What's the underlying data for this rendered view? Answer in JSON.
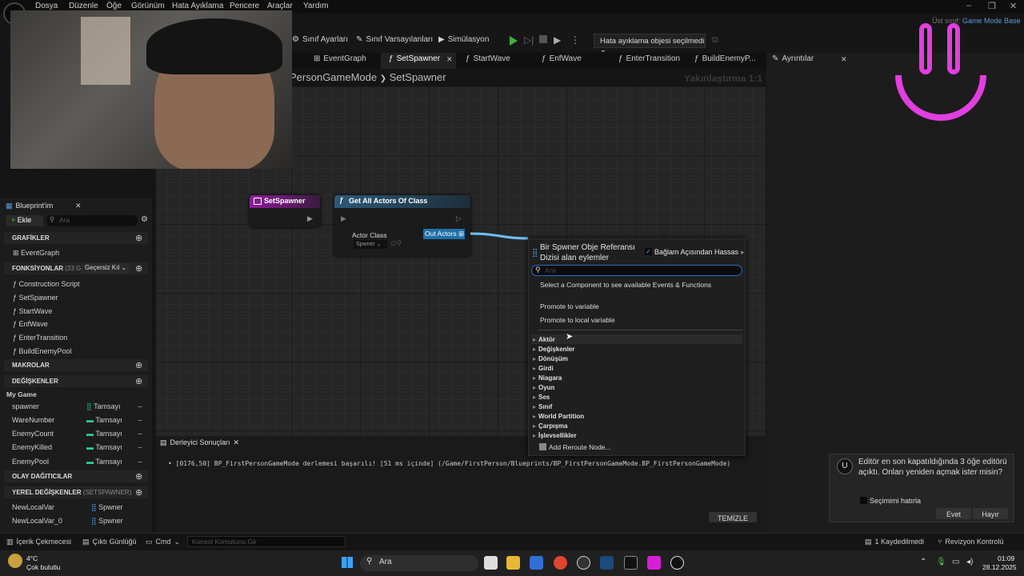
{
  "menubar": {
    "items": [
      "Dosya",
      "Düzenle",
      "Öğe",
      "Görünüm",
      "Hata Ayıklama",
      "Pencere",
      "Araçlar",
      "Yardım"
    ]
  },
  "parent_class": {
    "label": "Üst sınıf:",
    "value": "Game Mode Base"
  },
  "toolbar": {
    "class_settings": "Sınıf Ayarları",
    "class_defaults": "Sınıf Varsayılanları",
    "simulation": "Simülasyon",
    "debug_object": "Hata ayıklama objesi seçilmedi"
  },
  "tabs": [
    "EventGraph",
    "SetSpawner",
    "StartWave",
    "EnfWave",
    "EnterTransition",
    "BuildEnemyP..."
  ],
  "details_tab": "Ayrıntılar",
  "breadcrumb": {
    "parent": "PersonGameMode",
    "sep": "❯",
    "current": "SetSpawner"
  },
  "zoom_label": "Yakınlaştırma 1:1",
  "nodes": {
    "setspawner": {
      "title": "SetSpawner"
    },
    "getallactors": {
      "title": "Get All Actors Of Class",
      "actor_class_label": "Actor Class",
      "actor_class_value": "Spwner",
      "out_actors": "Out Actors"
    }
  },
  "blueprint_panel": {
    "title": "Blueprint'im",
    "add_label": "Ekle",
    "search_placeholder": "Ara",
    "graphs_header": "GRAFİKLER",
    "graphs": [
      "EventGraph"
    ],
    "functions_header": "FONKSİYONLAR",
    "functions_count": "(33 GEÇE",
    "override_label": "Geçersiz Kıl",
    "functions": [
      "Construction Script",
      "SetSpawner",
      "StartWave",
      "EnfWave",
      "EnterTransition",
      "BuildEnemyPool"
    ],
    "macros_header": "MAKROLAR",
    "variables_header": "DEĞİŞKENLER",
    "variable_category": "My Game",
    "variables": [
      {
        "name": "spawner",
        "type": "Tamsayı",
        "color": "#1fd6a0"
      },
      {
        "name": "WareNumber",
        "type": "Tamsayı",
        "color": "#1fd6a0"
      },
      {
        "name": "EnemyCount",
        "type": "Tamsayı",
        "color": "#1fd6a0"
      },
      {
        "name": "EnemyKilled",
        "type": "Tamsayı",
        "color": "#1fd6a0"
      },
      {
        "name": "EnemyPool",
        "type": "Tamsayı",
        "color": "#1fd6a0"
      }
    ],
    "dispatchers_header": "OLAY DAĞITICILAR",
    "local_vars_header": "YEREL DEĞİŞKENLER",
    "local_vars_scope": "(SETSPAWNER)",
    "local_vars": [
      {
        "name": "NewLocalVar",
        "type": "Spwner"
      },
      {
        "name": "NewLocalVar_0",
        "type": "Spwner"
      }
    ]
  },
  "compiler": {
    "tab_label": "Derleyici Sonuçları",
    "message": "[0176,50] BP_FirstPersonGameMode derlemesi başarılı! [51 ms içinde] (/Game/FirstPerson/Blueprints/BP_FirstPersonGameMode.BP_FirstPersonGameMode)",
    "clear_button": "TEMİZLE"
  },
  "context_menu": {
    "title_line1": "Bir Spwner Obje Referansı",
    "title_line2": "Dizisi alan eylemler",
    "context_sensitive_label": "Bağlam Açısından Hassas",
    "search_placeholder": "Ara",
    "hint": "Select a Component to see available Events & Functions",
    "actions": [
      "Promote to variable",
      "Promote to local variable"
    ],
    "categories": [
      "Aktör",
      "Değişkenler",
      "Dönüşüm",
      "Girdi",
      "Niagara",
      "Oyun",
      "Ses",
      "Sınıf",
      "World Partition",
      "Çarpışma",
      "İşlevsellikler"
    ],
    "reroute": "Add Reroute Node..."
  },
  "toast": {
    "message": "Editör en son kapatıldığında 3 öğe editörü açıktı. Onları yeniden açmak ister misin?",
    "remember_label": "Seçimimi hatırla",
    "yes": "Evet",
    "no": "Hayır"
  },
  "statusbar": {
    "content_drawer": "İçerik Çekmecesi",
    "output_log": "Çıktı Günlüğü",
    "cmd": "Cmd",
    "console_placeholder": "Konsol Komutunu Gir",
    "saved": "1 Kaydedilmedi",
    "revision": "Revizyon Kontrolü"
  },
  "taskbar": {
    "weather_temp": "4°C",
    "weather_desc": "Çok bulutlu",
    "search_label": "Ara",
    "time": "01:09",
    "date": "28.12.2025"
  }
}
